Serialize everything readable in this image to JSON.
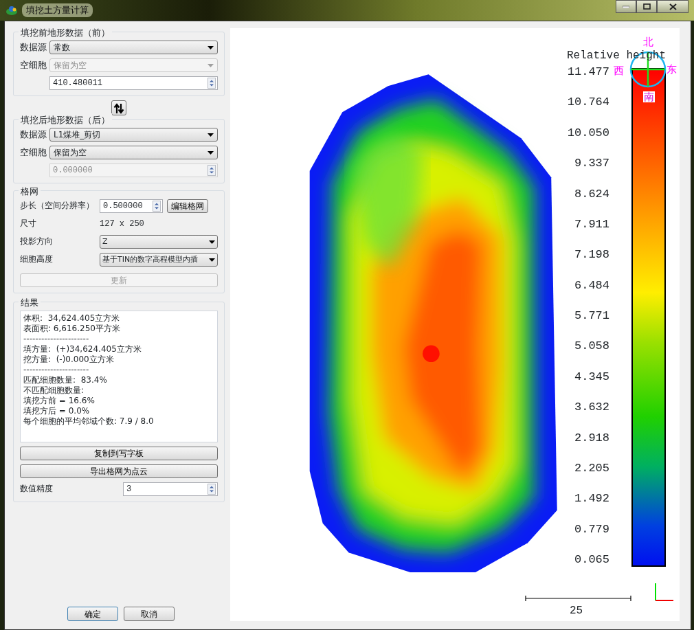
{
  "window": {
    "title": "填挖土方量计算"
  },
  "before": {
    "legend": "填挖前地形数据（前）",
    "rows": [
      {
        "kind": "select",
        "label": "数据源",
        "value": "常数",
        "disabled": false
      },
      {
        "kind": "select",
        "label": "空细胞",
        "value": "保留为空",
        "disabled": true
      },
      {
        "kind": "spin",
        "value": "410.480011",
        "disabled": false
      }
    ]
  },
  "after": {
    "legend": "填挖后地形数据（后）",
    "rows": [
      {
        "kind": "select",
        "label": "数据源",
        "value": "L1煤堆_剪切",
        "disabled": false
      },
      {
        "kind": "select",
        "label": "空细胞",
        "value": "保留为空",
        "disabled": false
      },
      {
        "kind": "spin",
        "value": "0.000000",
        "disabled": true
      }
    ]
  },
  "grid": {
    "legend": "格网",
    "rows": [
      {
        "kind": "spin",
        "label": "步长（空间分辨率）",
        "value": "0.500000",
        "disabled": false,
        "button": "编辑格网"
      },
      {
        "kind": "text",
        "label": "尺寸",
        "value": "127 x 250"
      },
      {
        "kind": "select",
        "label": "投影方向",
        "value": "Z",
        "disabled": false
      },
      {
        "kind": "select",
        "label": "细胞高度",
        "value": "基于TIN的数字高程模型内插",
        "disabled": false
      }
    ],
    "update_button": {
      "label": "更新",
      "disabled": true
    }
  },
  "results": {
    "legend": "结果",
    "lines": [
      "体积:  34,624.405立方米",
      "表面积: 6,616.250平方米",
      "----------------------",
      "填方量:  (+)34,624.405立方米",
      "挖方量:  (-)0.000立方米",
      "----------------------",
      "匹配细胞数量:  83.4%",
      "不匹配细胞数量:",
      "填挖方前 = 16.6%",
      "填挖方后 = 0.0%",
      "每个细胞的平均邻域个数: 7.9 / 8.0"
    ],
    "copy_button": "复制到写字板",
    "export_button": "导出格网为点云",
    "precision": {
      "label": "数值精度",
      "value": "3",
      "disabled": false
    }
  },
  "view": {
    "legend_title": "Relative height",
    "legend_labels": [
      "11.477",
      "10.764",
      "10.050",
      "9.337",
      "8.624",
      "7.911",
      "7.198",
      "6.484",
      "5.771",
      "5.058",
      "4.345",
      "3.632",
      "2.918",
      "2.205",
      "1.492",
      "0.779",
      "0.065"
    ],
    "compass": {
      "north": "北",
      "south": "南",
      "west": "西",
      "east": "东"
    },
    "scale_label": "25"
  },
  "buttons": [
    "确定",
    "取消"
  ]
}
